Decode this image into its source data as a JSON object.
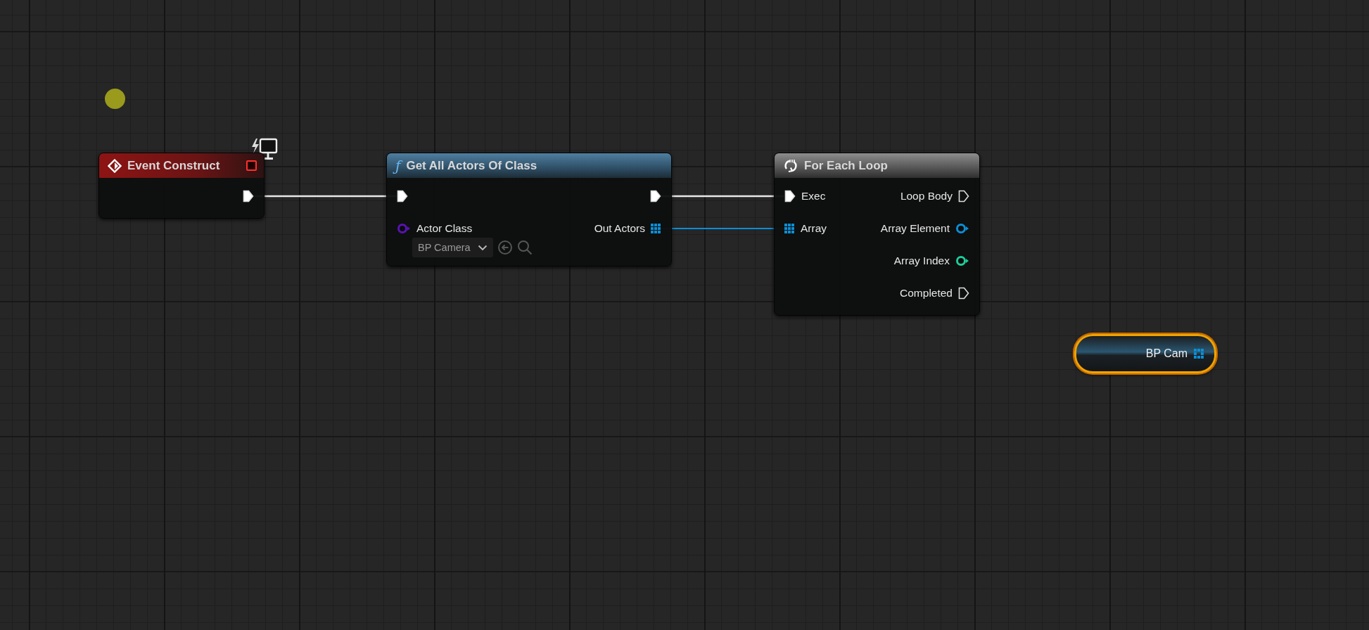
{
  "graph": {
    "nodes": [
      {
        "kind": "event",
        "title": "Event Construct",
        "rows": [
          {
            "out": {
              "kind": "exec",
              "connected": true
            }
          }
        ]
      },
      {
        "kind": "function",
        "glyph": "ƒ",
        "title": "Get All Actors Of Class",
        "rows": [
          {
            "in": {
              "kind": "exec",
              "connected": true
            },
            "out": {
              "kind": "exec",
              "connected": true
            }
          },
          {
            "in": {
              "kind": "class",
              "label": "Actor Class",
              "connected": false,
              "value": "BP Camera"
            },
            "out": {
              "kind": "array",
              "label": "Out Actors",
              "connected": true
            }
          }
        ]
      },
      {
        "kind": "macro",
        "title": "For Each Loop",
        "rows": [
          {
            "in": {
              "kind": "exec",
              "label": "Exec",
              "connected": true
            },
            "out": {
              "kind": "exec",
              "label": "Loop Body",
              "connected": false
            }
          },
          {
            "in": {
              "kind": "array",
              "label": "Array",
              "connected": true
            },
            "out": {
              "kind": "object",
              "label": "Array Element",
              "connected": false
            }
          },
          {
            "out": {
              "kind": "int",
              "label": "Array Index",
              "connected": false
            }
          },
          {
            "out": {
              "kind": "exec",
              "label": "Completed",
              "connected": false
            }
          }
        ]
      },
      {
        "kind": "variable",
        "label": "BP Cam",
        "selected": true
      }
    ]
  }
}
